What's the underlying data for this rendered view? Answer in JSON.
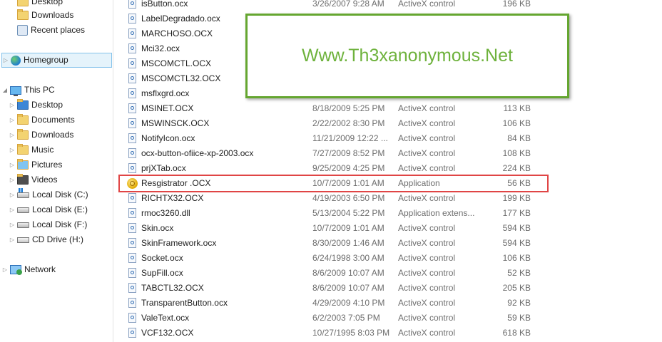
{
  "nav": {
    "items": [
      {
        "label": "Desktop",
        "icon": "folder-icon"
      },
      {
        "label": "Downloads",
        "icon": "folder-icon"
      },
      {
        "label": "Recent places",
        "icon": "recent-places-icon"
      },
      {
        "label": "Homegroup",
        "icon": "homegroup-icon"
      },
      {
        "label": "This PC",
        "icon": "computer-icon"
      },
      {
        "label": "Desktop",
        "icon": "desktop-folder-icon"
      },
      {
        "label": "Documents",
        "icon": "documents-folder-icon"
      },
      {
        "label": "Downloads",
        "icon": "downloads-folder-icon"
      },
      {
        "label": "Music",
        "icon": "music-folder-icon"
      },
      {
        "label": "Pictures",
        "icon": "pictures-folder-icon"
      },
      {
        "label": "Videos",
        "icon": "videos-folder-icon"
      },
      {
        "label": "Local Disk (C:)",
        "icon": "windows-drive-icon"
      },
      {
        "label": "Local Disk (E:)",
        "icon": "drive-icon"
      },
      {
        "label": "Local Disk (F:)",
        "icon": "drive-icon"
      },
      {
        "label": "CD Drive (H:)",
        "icon": "cd-drive-icon"
      },
      {
        "label": "Network",
        "icon": "network-icon"
      }
    ]
  },
  "files": [
    {
      "name": "isButton.ocx",
      "date": "3/26/2007 9:28 AM",
      "type": "ActiveX control",
      "size": "196 KB"
    },
    {
      "name": "LabelDegradado.ocx",
      "date": "",
      "type": "",
      "size": ""
    },
    {
      "name": "MARCHOSO.OCX",
      "date": "",
      "type": "",
      "size": ""
    },
    {
      "name": "Mci32.ocx",
      "date": "",
      "type": "",
      "size": ""
    },
    {
      "name": "MSCOMCTL.OCX",
      "date": "",
      "type": "",
      "size": ""
    },
    {
      "name": "MSCOMCTL32.OCX",
      "date": "",
      "type": "",
      "size": ""
    },
    {
      "name": "msflxgrd.ocx",
      "date": "",
      "type": "",
      "size": ""
    },
    {
      "name": "MSINET.OCX",
      "date": "8/18/2009 5:25 PM",
      "type": "ActiveX control",
      "size": "113 KB"
    },
    {
      "name": "MSWINSCK.OCX",
      "date": "2/22/2002 8:30 PM",
      "type": "ActiveX control",
      "size": "106 KB"
    },
    {
      "name": "NotifyIcon.ocx",
      "date": "11/21/2009 12:22 ...",
      "type": "ActiveX control",
      "size": "84 KB"
    },
    {
      "name": "ocx-button-ofiice-xp-2003.ocx",
      "date": "7/27/2009 8:52 PM",
      "type": "ActiveX control",
      "size": "108 KB"
    },
    {
      "name": "prjXTab.ocx",
      "date": "9/25/2009 4:25 PM",
      "type": "ActiveX control",
      "size": "224 KB"
    },
    {
      "name": "Resgistrator .OCX",
      "date": "10/7/2009 1:01 AM",
      "type": "Application",
      "size": "56 KB",
      "app": true
    },
    {
      "name": "RICHTX32.OCX",
      "date": "4/19/2003 6:50 PM",
      "type": "ActiveX control",
      "size": "199 KB"
    },
    {
      "name": "rmoc3260.dll",
      "date": "5/13/2004 5:22 PM",
      "type": "Application extens...",
      "size": "177 KB"
    },
    {
      "name": "Skin.ocx",
      "date": "10/7/2009 1:01 AM",
      "type": "ActiveX control",
      "size": "594 KB"
    },
    {
      "name": "SkinFramework.ocx",
      "date": "8/30/2009 1:46 AM",
      "type": "ActiveX control",
      "size": "594 KB"
    },
    {
      "name": "Socket.ocx",
      "date": "6/24/1998 3:00 AM",
      "type": "ActiveX control",
      "size": "106 KB"
    },
    {
      "name": "SupFill.ocx",
      "date": "8/6/2009 10:07 AM",
      "type": "ActiveX control",
      "size": "52 KB"
    },
    {
      "name": "TABCTL32.OCX",
      "date": "8/6/2009 10:07 AM",
      "type": "ActiveX control",
      "size": "205 KB"
    },
    {
      "name": "TransparentButton.ocx",
      "date": "4/29/2009 4:10 PM",
      "type": "ActiveX control",
      "size": "92 KB"
    },
    {
      "name": "ValeText.ocx",
      "date": "6/2/2003 7:05 PM",
      "type": "ActiveX control",
      "size": "59 KB"
    },
    {
      "name": "VCF132.OCX",
      "date": "10/27/1995 8:03 PM",
      "type": "ActiveX control",
      "size": "618 KB"
    }
  ],
  "watermark": {
    "text": "Www.Th3xanonymous.Net",
    "color": "#6eb23c",
    "border_color": "#65a630"
  },
  "highlight": {
    "color": "#e04545"
  },
  "colors": {
    "nav_selected_bg": "#e5f3fb",
    "nav_selected_border": "#84c2eb"
  }
}
